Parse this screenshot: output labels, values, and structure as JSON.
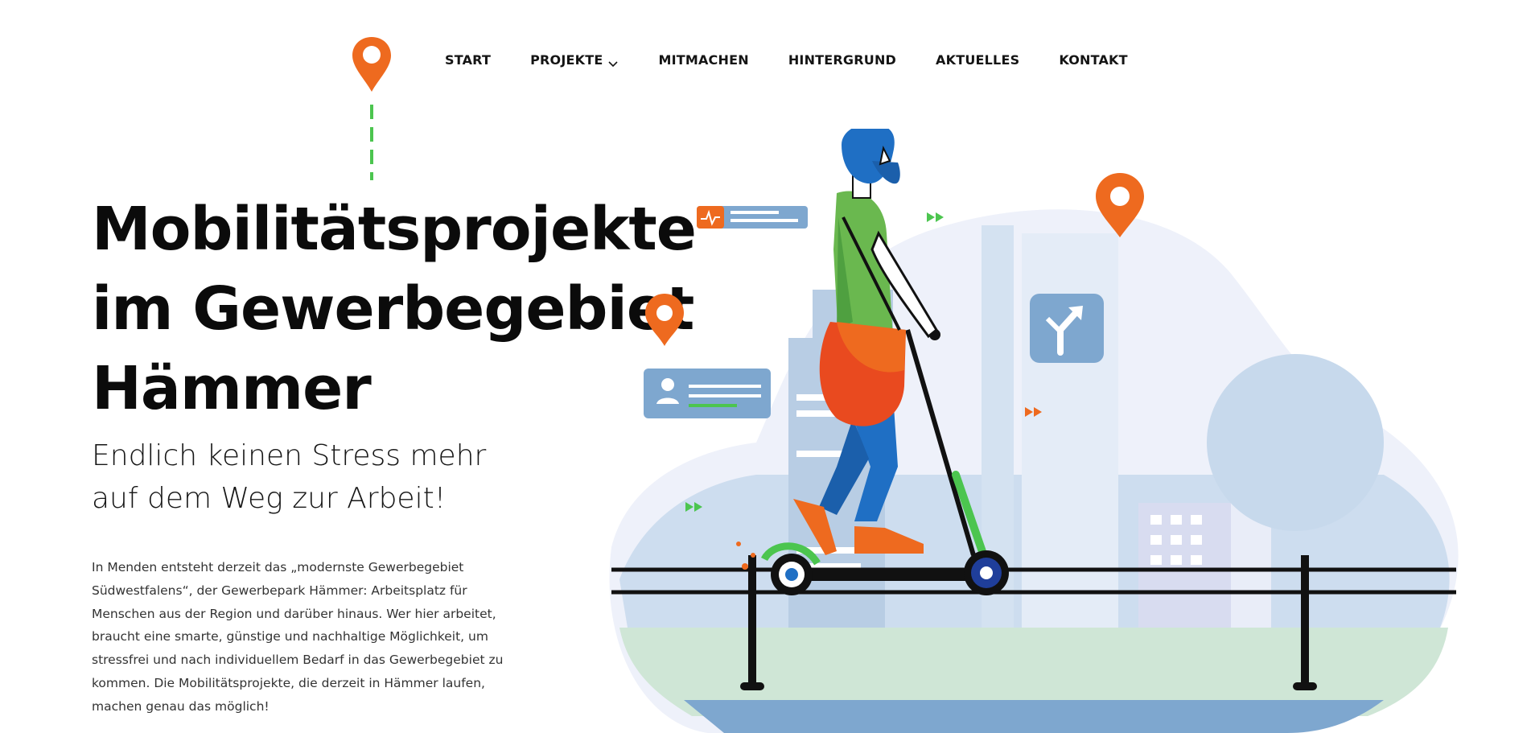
{
  "nav": {
    "items": [
      {
        "label": "START"
      },
      {
        "label": "PROJEKTE"
      },
      {
        "label": "MITMACHEN"
      },
      {
        "label": "HINTERGRUND"
      },
      {
        "label": "AKTUELLES"
      },
      {
        "label": "KONTAKT"
      }
    ]
  },
  "hero": {
    "title_lines": [
      "Mobilitätsprojekte",
      "im Gewerbegebiet",
      "Hämmer"
    ],
    "subtitle_lines": [
      "Endlich keinen Stress mehr",
      "auf dem Weg zur Arbeit!"
    ],
    "body_lines": [
      "In Menden entsteht derzeit das „modernste Gewerbegebiet",
      "Südwestfalens“, der Gewerbepark Hämmer: Arbeitsplatz für",
      "Menschen aus der Region und darüber hinaus. Wer hier arbeitet,",
      "braucht eine smarte, günstige und nachhaltige Möglichkeit, um",
      "stressfrei und nach individuellem Bedarf in das Gewerbegebiet zu",
      "kommen. Die Mobilitätsprojekte, die derzeit in Hämmer laufen,",
      "machen genau das möglich!"
    ]
  },
  "colors": {
    "accent_orange": "#ee6a1f",
    "accent_green": "#4cc54f",
    "accent_blue": "#1f6fc4",
    "sky_blue": "#c7d9ec"
  },
  "icons": {
    "logo": "map-pin-icon",
    "dropdown": "chevron-down-icon"
  }
}
